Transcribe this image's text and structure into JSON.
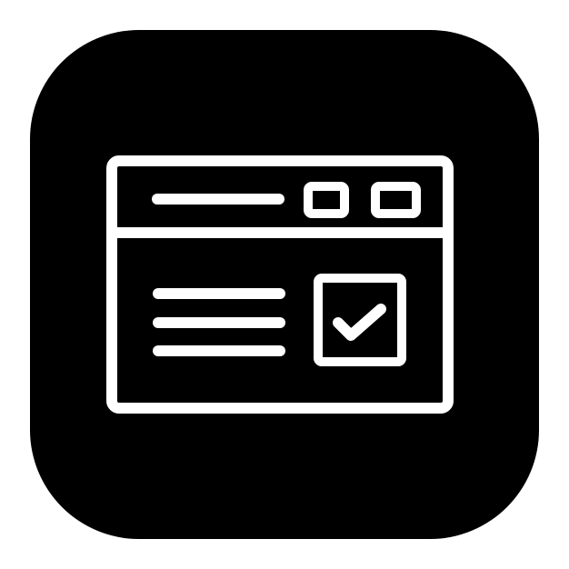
{
  "icon": {
    "name": "browser-window-checkbox-icon",
    "tile_color": "#000000",
    "line_color": "#ffffff",
    "background_color": "#ffffff"
  }
}
